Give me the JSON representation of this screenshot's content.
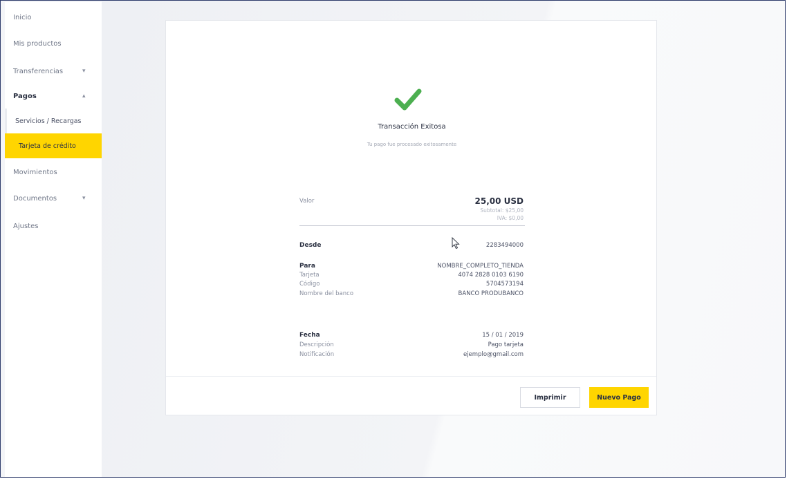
{
  "sidebar": {
    "items": [
      {
        "label": "Inicio"
      },
      {
        "label": "Mis productos"
      },
      {
        "label": "Transferencias"
      },
      {
        "label": "Pagos"
      },
      {
        "label": "Movimientos"
      },
      {
        "label": "Documentos"
      },
      {
        "label": "Ajustes"
      }
    ],
    "sub_items": [
      {
        "label": "Servicios / Recargas"
      },
      {
        "label": "Tarjeta de crédito"
      }
    ]
  },
  "receipt": {
    "title": "Transacción Exitosa",
    "subtitle": "Tu pago fue procesado exitosamente",
    "amount_label": "Valor",
    "amount_value": "25,00 USD",
    "amount_sub1": "Subtotal: $25,00",
    "amount_sub2": "IVA: $0,00",
    "from_label": "Desde",
    "from_value": "2283494000",
    "to_label": "Para",
    "to_value": "NOMBRE_COMPLETO_TIENDA",
    "card_label": "Tarjeta",
    "card_value": "4074 2828 0103 6190",
    "code_label": "Código",
    "code_value": "5704573194",
    "bank_label": "Nombre del banco",
    "bank_value": "BANCO PRODUBANCO",
    "date_label": "Fecha",
    "date_value": "15 / 01 / 2019",
    "desc_label": "Descripción",
    "desc_value": "Pago tarjeta",
    "notif_label": "Notificación",
    "notif_value": "ejemplo@gmail.com"
  },
  "buttons": {
    "print": "Imprimir",
    "new_payment": "Nuevo Pago"
  },
  "colors": {
    "accent": "#ffd500",
    "success": "#4caf50"
  }
}
